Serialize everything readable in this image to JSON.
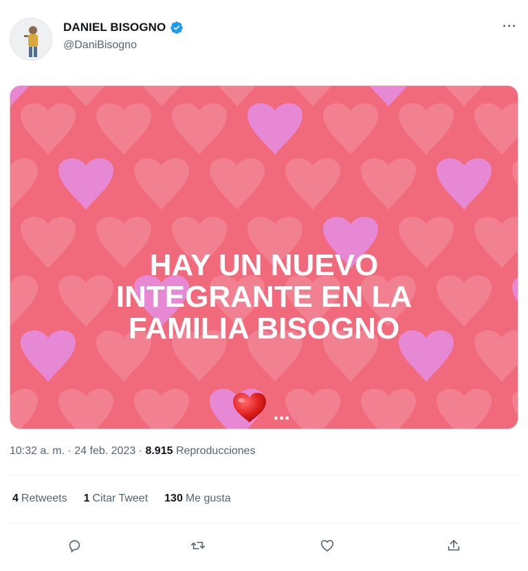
{
  "author": {
    "display_name": "DANIEL BISOGNO",
    "handle": "@DaniBisogno",
    "verified_icon": "verified-badge-icon",
    "accent": "#1d9bf0"
  },
  "menu": {
    "more_label": "···"
  },
  "media": {
    "headline": [
      "HAY UN NUEVO",
      "INTEGRANTE EN LA",
      "FAMILIA BISOGNO"
    ],
    "emoji": "❤️",
    "trailing": "...",
    "bg_color": "#f06a7c",
    "heart_colors": [
      "#f28a97",
      "#e58ad8"
    ]
  },
  "meta": {
    "time": "10:32 a. m.",
    "sep1": " · ",
    "date": "24 feb. 2023",
    "sep2": " · ",
    "views": "8.915",
    "views_label": "Reproducciones"
  },
  "stats": {
    "retweets_count": "4",
    "retweets_label": "Retweets",
    "quotes_count": "1",
    "quotes_label": "Citar Tweet",
    "likes_count": "130",
    "likes_label": "Me gusta"
  },
  "actions": [
    "reply-icon",
    "retweet-icon",
    "like-icon",
    "share-icon"
  ]
}
